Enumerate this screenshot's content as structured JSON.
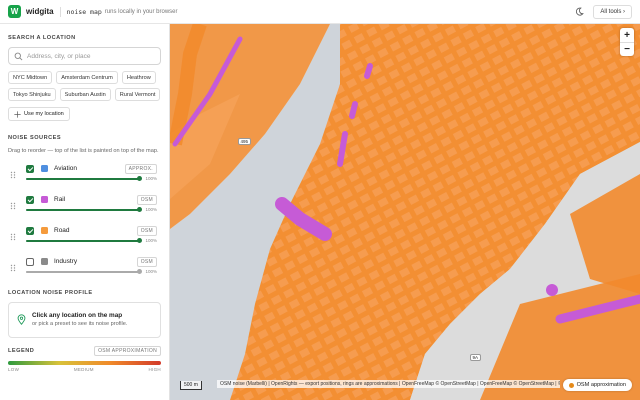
{
  "header": {
    "logo_letter": "W",
    "brand": "widgita",
    "tool_name": "noise map",
    "tagline": "runs locally in your browser",
    "all_tools_label": "All tools",
    "theme_icon": "moon-icon"
  },
  "search": {
    "section_title": "SEARCH A LOCATION",
    "placeholder": "Address, city, or place",
    "presets": [
      "NYC Midtown",
      "Amsterdam Centrum",
      "Heathrow",
      "Tokyo Shinjuku",
      "Suburban Austin",
      "Rural Vermont"
    ],
    "use_my_location": "Use my location"
  },
  "sources": {
    "section_title": "NOISE SOURCES",
    "hint": "Drag to reorder — top of the list is painted on top of the map.",
    "items": [
      {
        "name": "Aviation",
        "badge": "APPROX.",
        "checked": true,
        "color": "#4f8fe0",
        "level": 100,
        "pct_label": "100%"
      },
      {
        "name": "Rail",
        "badge": "OSM",
        "checked": true,
        "color": "#c65bd6",
        "level": 100,
        "pct_label": "100%"
      },
      {
        "name": "Road",
        "badge": "OSM",
        "checked": true,
        "color": "#f59b3c",
        "level": 100,
        "pct_label": "100%"
      },
      {
        "name": "Industry",
        "badge": "OSM",
        "checked": false,
        "color": "#8a8a8a",
        "level": 100,
        "pct_label": "100%"
      }
    ]
  },
  "profile": {
    "section_title": "LOCATION NOISE PROFILE",
    "title": "Click any location on the map",
    "subtitle": "or pick a preset to see its noise profile."
  },
  "legend": {
    "section_title": "LEGEND",
    "badge": "OSM APPROXIMATION",
    "low": "LOW",
    "medium": "MEDIUM",
    "high": "HIGH"
  },
  "map": {
    "zoom_in": "+",
    "zoom_out": "−",
    "scale": "500 m",
    "road_label_1": "495",
    "road_label_2": "9A",
    "attribution": "OSM noise (Marbelli) | OpenRights — export positions, rings are approximations | OpenFreeMap © OpenStreetMap | OpenFreeMap © OpenStreetMap | © OpenMapTiles © Op",
    "osm_pill": "OSM approximation",
    "colors": {
      "road": "#f59b3c",
      "rail": "#c65bd6",
      "water": "#cfd4da",
      "land": "#e9e9e9"
    }
  }
}
